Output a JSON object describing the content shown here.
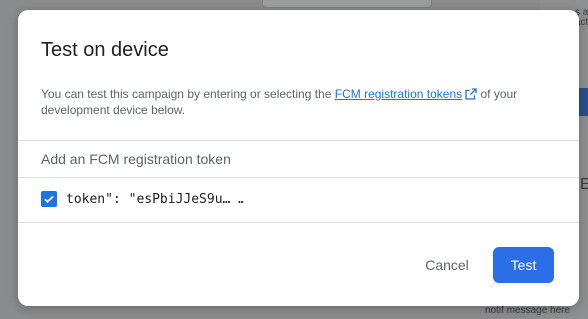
{
  "background": {
    "right_text": "s a act",
    "bottom_hint": "notif message here"
  },
  "dialog": {
    "title": "Test on device",
    "description_before": "You can test this campaign by entering or selecting the ",
    "description_link": "FCM registration tokens",
    "description_after": " of your development device below.",
    "add_token_label": "Add an FCM registration token",
    "token": {
      "checked": true,
      "text": "token\": \"esPbiJJeS9u…                       …_BdKGEUm…"
    },
    "cancel_label": "Cancel",
    "test_label": "Test"
  },
  "colors": {
    "accent": "#1a73e8",
    "primary_button": "#2b6ee8",
    "overlay": "#8a8b8d"
  },
  "icons": {
    "external_link": "open-in-new-icon",
    "checkbox": "check-icon"
  }
}
